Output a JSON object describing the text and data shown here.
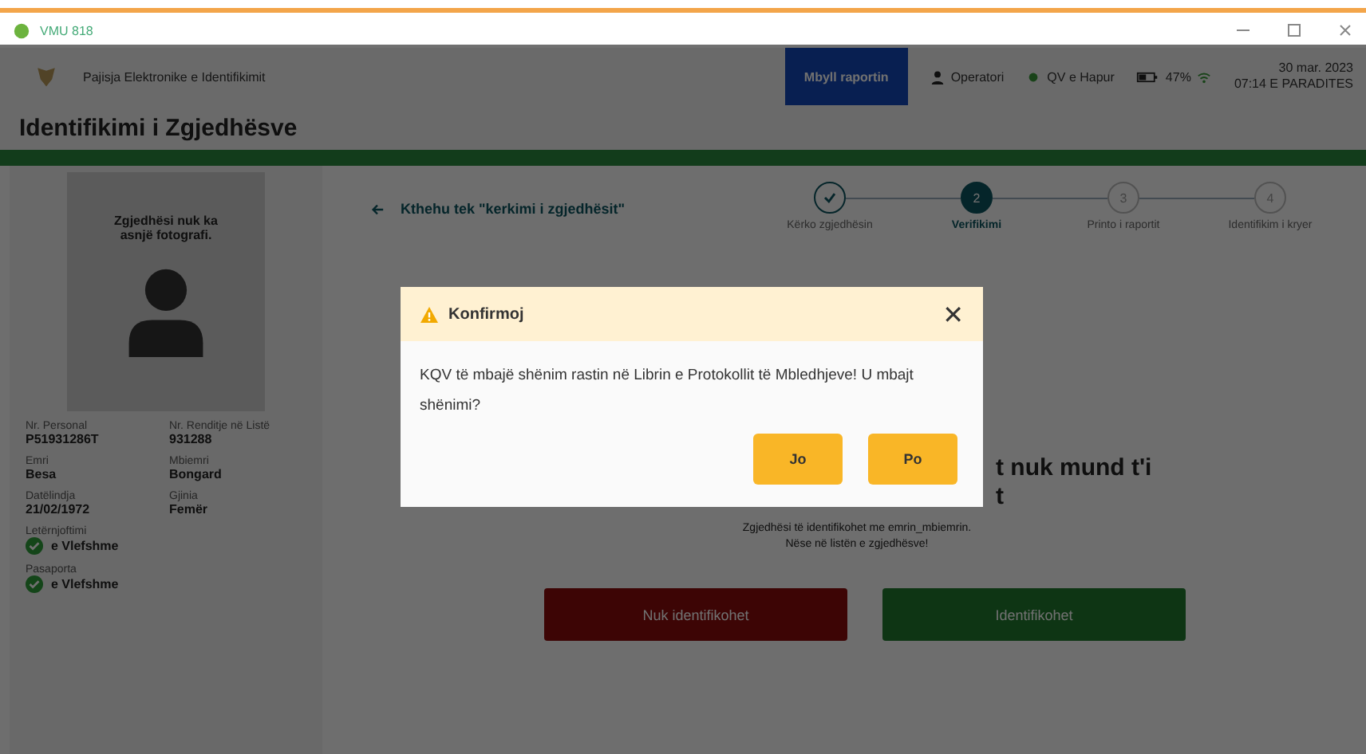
{
  "window": {
    "title": "VMU 818"
  },
  "header": {
    "app_name": "Pajisja Elektronike e Identifikimit",
    "report_button": "Mbyll raportin",
    "operator": "Operatori",
    "station_status": "QV e Hapur",
    "battery": "47%",
    "date": "30 mar. 2023",
    "time": "07:14 E PARADITES"
  },
  "page_title": "Identifikimi i Zgjedhësve",
  "voter": {
    "photo_note": "Zgjedhësi nuk ka asnjë fotografi.",
    "fields": [
      {
        "label": "Nr. Personal",
        "value": "P51931286T"
      },
      {
        "label": "Nr. Renditje në Listë",
        "value": "931288"
      },
      {
        "label": "Emri",
        "value": "Besa"
      },
      {
        "label": "Mbiemri",
        "value": "Bongard"
      },
      {
        "label": "Datëlindja",
        "value": "21/02/1972"
      },
      {
        "label": "Gjinia",
        "value": "Femër"
      }
    ],
    "documents": [
      {
        "label": "Letërnjoftimi",
        "status": "e Vlefshme",
        "valid": true
      },
      {
        "label": "Pasaporta",
        "status": "e Vlefshme",
        "valid": true
      }
    ]
  },
  "back_link": "Kthehu tek \"kerkimi i zgjedhësit\"",
  "steps": [
    {
      "label": "Kërko zgjedhësin",
      "kind": "done"
    },
    {
      "marker": "2",
      "label": "Verifikimi",
      "kind": "current"
    },
    {
      "marker": "3",
      "label": "Printo i raportit",
      "kind": "todo"
    },
    {
      "marker": "4",
      "label": "Identifikim i kryer",
      "kind": "todo"
    }
  ],
  "verification": {
    "heading_lines": [
      "t nuk mund t'i",
      "t"
    ],
    "note_lines": [
      "Zgjedhësi të identifikohet me emrin_mbiemrin.",
      "Nëse në listën e zgjedhësve!"
    ],
    "reject_button": "Nuk identifikohet",
    "accept_button": "Identifikohet"
  },
  "dialog": {
    "title": "Konfirmoj",
    "close": "✕",
    "message": "KQV të mbajë shënim rastin në Librin e Protokollit të Mbledhjeve! U mbajt shënimi?",
    "buttons": [
      "Jo",
      "Po"
    ]
  }
}
